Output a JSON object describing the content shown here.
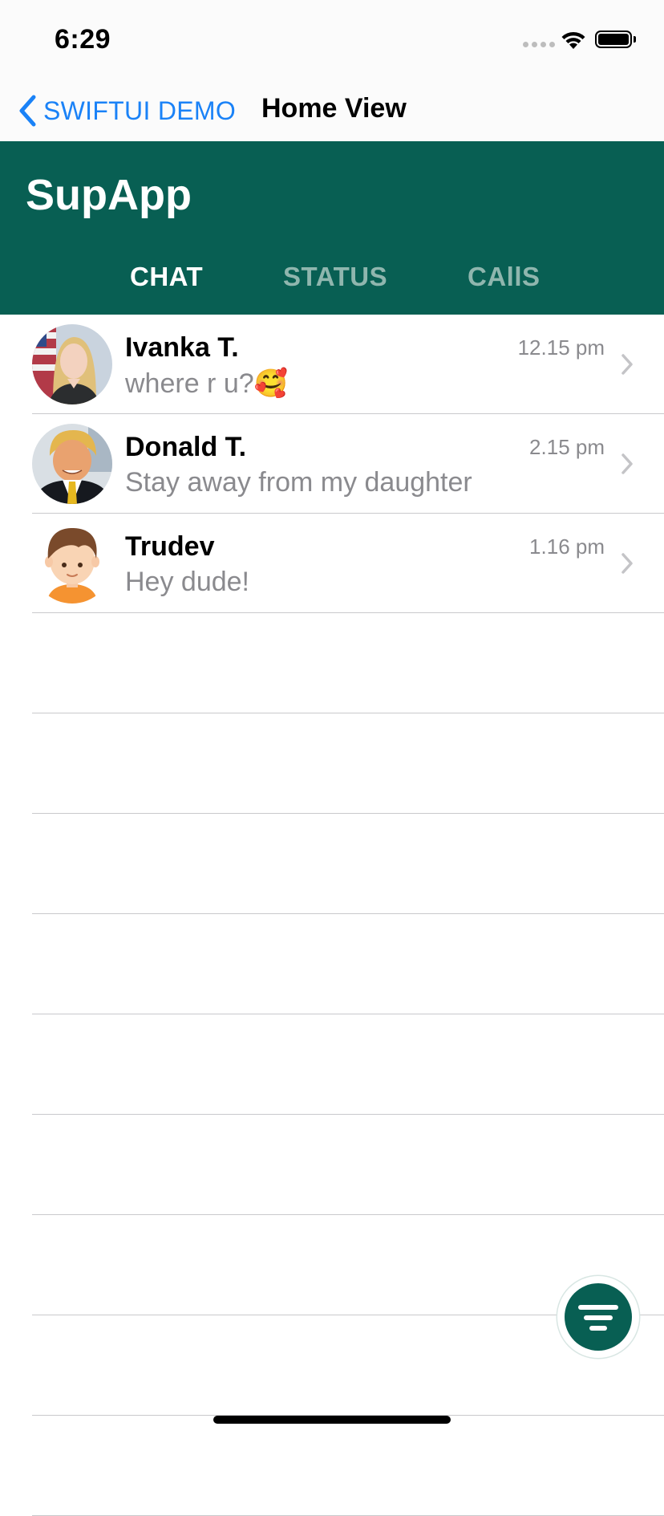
{
  "status_bar": {
    "time": "6:29"
  },
  "nav": {
    "back_label": "SWIFTUI DEMO",
    "title": "Home View"
  },
  "app": {
    "title": "SupApp",
    "brand_color": "#085f53"
  },
  "tabs": [
    {
      "label": "CHAT",
      "active": true
    },
    {
      "label": "STATUS",
      "active": false
    },
    {
      "label": "CAllS",
      "active": false
    }
  ],
  "chats": [
    {
      "name": "Ivanka T.",
      "message": "where r u?",
      "emoji": "🥰",
      "time": "12.15 pm",
      "avatar": "woman-portrait-avatar"
    },
    {
      "name": "Donald T.",
      "message": "Stay away from my daughter",
      "time": "2.15 pm",
      "avatar": "man-suit-portrait-avatar"
    },
    {
      "name": "Trudev",
      "message": "Hey dude!",
      "time": "1.16 pm",
      "avatar": "cartoon-boy-avatar"
    }
  ],
  "fab": {
    "icon": "filter-lines-icon"
  }
}
